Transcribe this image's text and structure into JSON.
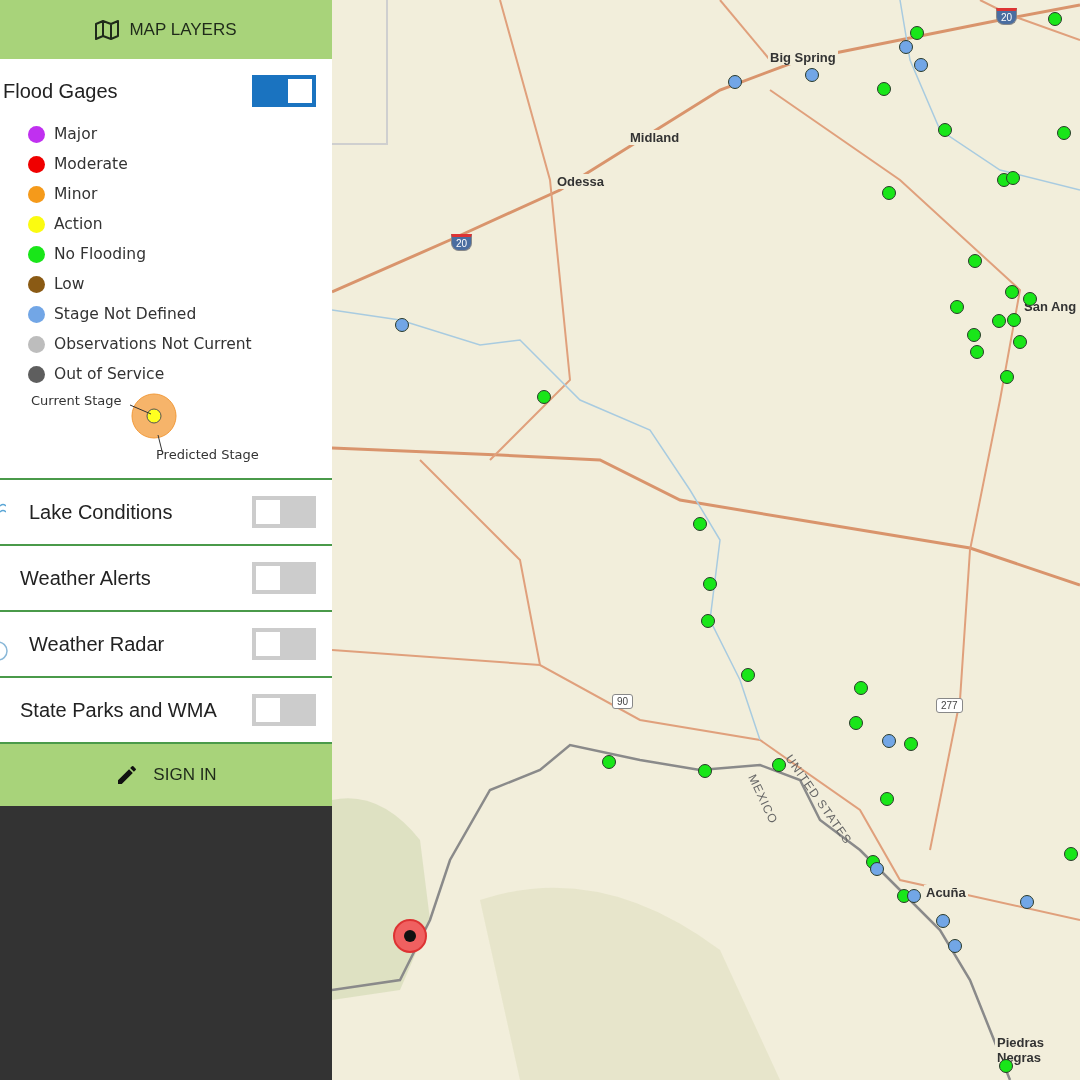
{
  "header": {
    "title": "MAP LAYERS"
  },
  "flood_gages": {
    "title": "Flood Gages",
    "on": true,
    "legend": [
      {
        "label": "Major",
        "color": "#c030f0"
      },
      {
        "label": "Moderate",
        "color": "#f00000"
      },
      {
        "label": "Minor",
        "color": "#f59a1a"
      },
      {
        "label": "Action",
        "color": "#fbfb10"
      },
      {
        "label": "No Flooding",
        "color": "#19e619"
      },
      {
        "label": "Low",
        "color": "#8a5a14"
      },
      {
        "label": "Stage Not Defined",
        "color": "#72a6e6"
      },
      {
        "label": "Observations Not Current",
        "color": "#bdbdbd"
      },
      {
        "label": "Out of Service",
        "color": "#5e5e5e"
      }
    ],
    "stage_key": {
      "current": "Current Stage",
      "predicted": "Predicted Stage"
    }
  },
  "layers": [
    {
      "label": "Lake Conditions",
      "on": false
    },
    {
      "label": "Weather Alerts",
      "on": false
    },
    {
      "label": "Weather Radar",
      "on": false
    },
    {
      "label": "State Parks and WMA",
      "on": false
    }
  ],
  "sign_in": {
    "label": "SIGN IN"
  },
  "map": {
    "places": [
      "Big Spring",
      "Midland",
      "Odessa",
      "San Ang",
      "Acuña",
      "Piedras Negras"
    ],
    "country_labels": [
      "UNITED STATES",
      "MEXICO"
    ],
    "shields": [
      "20",
      "20",
      "90",
      "277"
    ],
    "gages": [
      {
        "color": "#19e619"
      },
      {
        "color": "#19e619"
      },
      {
        "color": "#19e619"
      },
      {
        "color": "#19e619"
      },
      {
        "color": "#19e619"
      },
      {
        "color": "#19e619"
      },
      {
        "color": "#19e619"
      },
      {
        "color": "#19e619"
      },
      {
        "color": "#19e619"
      },
      {
        "color": "#19e619"
      },
      {
        "color": "#19e619"
      },
      {
        "color": "#19e619"
      },
      {
        "color": "#19e619"
      },
      {
        "color": "#19e619"
      },
      {
        "color": "#19e619"
      },
      {
        "color": "#19e619"
      },
      {
        "color": "#19e619"
      },
      {
        "color": "#19e619"
      },
      {
        "color": "#19e619"
      },
      {
        "color": "#19e619"
      },
      {
        "color": "#19e619"
      },
      {
        "color": "#19e619"
      },
      {
        "color": "#19e619"
      },
      {
        "color": "#19e619"
      },
      {
        "color": "#19e619"
      },
      {
        "color": "#19e619"
      },
      {
        "color": "#19e619"
      },
      {
        "color": "#19e619"
      },
      {
        "color": "#19e619"
      },
      {
        "color": "#19e619"
      },
      {
        "color": "#19e619"
      },
      {
        "color": "#19e619"
      },
      {
        "color": "#19e619"
      },
      {
        "color": "#19e619"
      },
      {
        "color": "#72a6e6"
      },
      {
        "color": "#72a6e6"
      },
      {
        "color": "#72a6e6"
      },
      {
        "color": "#72a6e6"
      },
      {
        "color": "#72a6e6"
      },
      {
        "color": "#72a6e6"
      },
      {
        "color": "#72a6e6"
      },
      {
        "color": "#72a6e6"
      },
      {
        "color": "#72a6e6"
      },
      {
        "color": "#72a6e6"
      },
      {
        "color": "#72a6e6"
      }
    ]
  }
}
